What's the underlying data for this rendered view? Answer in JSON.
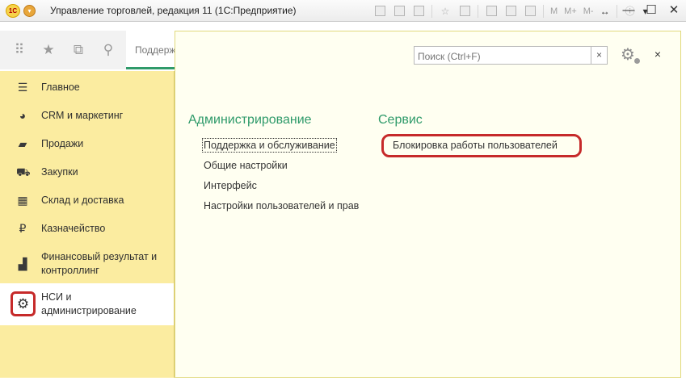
{
  "window": {
    "title": "Управление торговлей, редакция 11  (1С:Предприятие)",
    "logo_text": "1С",
    "toolbar_text": [
      "M",
      "M+",
      "M-"
    ],
    "toolbar_icons": [
      "save-icon",
      "print-icon",
      "preview-icon",
      "favorites-icon",
      "bookmark-icon",
      "calculator-icon",
      "calendar-icon",
      "compare-icon",
      "resize-icon",
      "info-icon",
      "menu-down-icon"
    ],
    "controls": [
      "minimize",
      "maximize",
      "close"
    ]
  },
  "nav_toolbar": {
    "icons": [
      "apps-grid-icon",
      "favorites-star-icon",
      "history-icon",
      "search-icon"
    ],
    "open_tab_label": "Поддерж"
  },
  "sidebar": {
    "items": [
      {
        "label": "Главное",
        "icon": "menu-lines-icon"
      },
      {
        "label": "CRM и маркетинг",
        "icon": "pie-chart-icon"
      },
      {
        "label": "Продажи",
        "icon": "shopping-bag-icon"
      },
      {
        "label": "Закупки",
        "icon": "cart-icon"
      },
      {
        "label": "Склад и доставка",
        "icon": "warehouse-icon"
      },
      {
        "label": "Казначейство",
        "icon": "ruble-icon"
      },
      {
        "label": "Финансовый результат и контроллинг",
        "icon": "bar-chart-icon"
      },
      {
        "label": "НСИ и администрирование",
        "icon": "gear-icon",
        "active": true
      }
    ]
  },
  "main": {
    "search_placeholder": "Поиск (Ctrl+F)",
    "clear_label": "×",
    "close_label": "×",
    "sections": [
      {
        "title": "Администрирование",
        "links": [
          "Поддержка и обслуживание",
          "Общие настройки",
          "Интерфейс",
          "Настройки пользователей и прав"
        ]
      },
      {
        "title": "Сервис",
        "links": [
          "Блокировка работы пользователей"
        ]
      }
    ]
  },
  "colors": {
    "sidebar_bg": "#fbeca0",
    "main_bg": "#fffff1",
    "section_title": "#2e9a6a",
    "highlight": "#c62a2a"
  }
}
